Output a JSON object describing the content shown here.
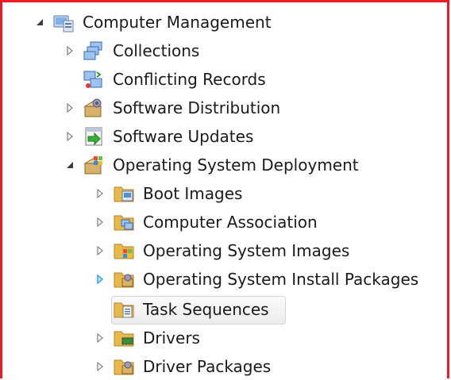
{
  "tree": {
    "root": {
      "label": "Computer Management",
      "icon": "computer-management-icon",
      "expanded": true
    },
    "items": [
      {
        "label": "Collections",
        "icon": "collections-icon",
        "expander": "collapsed"
      },
      {
        "label": "Conflicting Records",
        "icon": "conflicting-records-icon",
        "expander": "none"
      },
      {
        "label": "Software Distribution",
        "icon": "software-distribution-icon",
        "expander": "collapsed"
      },
      {
        "label": "Software Updates",
        "icon": "software-updates-icon",
        "expander": "collapsed"
      },
      {
        "label": "Operating System Deployment",
        "icon": "os-deployment-icon",
        "expander": "expanded"
      }
    ],
    "osd_children": [
      {
        "label": "Boot Images",
        "icon": "boot-images-folder-icon",
        "expander": "collapsed"
      },
      {
        "label": "Computer Association",
        "icon": "computer-association-folder-icon",
        "expander": "collapsed"
      },
      {
        "label": "Operating System Images",
        "icon": "os-images-folder-icon",
        "expander": "collapsed"
      },
      {
        "label": "Operating System Install Packages",
        "icon": "os-install-packages-folder-icon",
        "expander": "hover"
      },
      {
        "label": "Task Sequences",
        "icon": "task-sequences-folder-icon",
        "expander": "none",
        "selected": true
      },
      {
        "label": "Drivers",
        "icon": "drivers-folder-icon",
        "expander": "collapsed"
      },
      {
        "label": "Driver Packages",
        "icon": "driver-packages-folder-icon",
        "expander": "collapsed"
      }
    ]
  },
  "colors": {
    "frame": "#ed1c24",
    "folder": "#e8b84a",
    "expander_hover": "#1e9be8",
    "expander": "#8a8a8a"
  }
}
